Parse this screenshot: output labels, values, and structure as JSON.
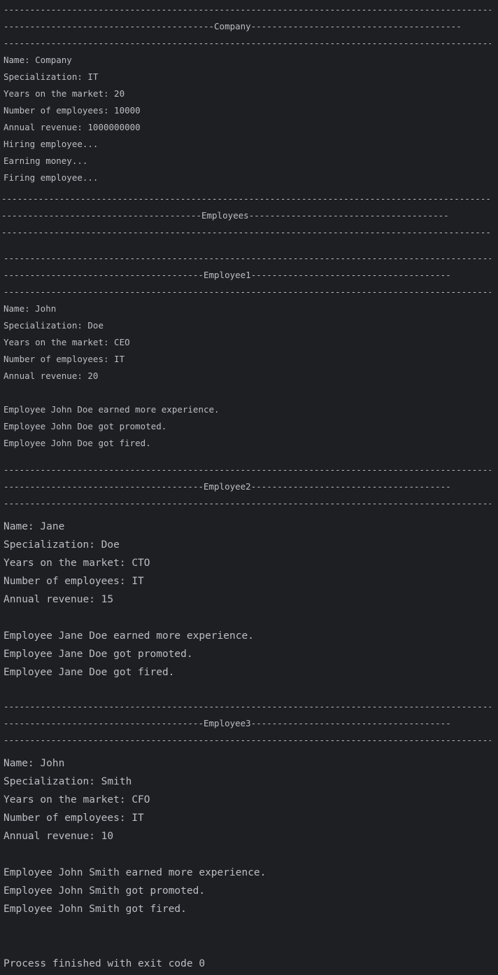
{
  "console": {
    "company": {
      "dash_line": "------------------------------------------------------------------------------------------------",
      "header": "----------------------------------------Company----------------------------------------",
      "lines": [
        "Name: Company",
        "Specialization: IT",
        "Years on the market: 20",
        "Number of employees: 10000",
        "Annual revenue: 1000000000",
        "Hiring employee...",
        "Earning money...",
        "Firing employee..."
      ]
    },
    "employees_section": {
      "dash_line": "------------------------------------------------------------------------------------------------",
      "header": "--------------------------------------Employees--------------------------------------"
    },
    "employee1": {
      "dash_line": "------------------------------------------------------------------------------------------------",
      "header": "--------------------------------------Employee1--------------------------------------",
      "lines": [
        "Name: John",
        "Specialization: Doe",
        "Years on the market: CEO",
        "Number of employees: IT",
        "Annual revenue: 20"
      ],
      "actions": [
        "Employee John Doe earned more experience.",
        "Employee John Doe got promoted.",
        "Employee John Doe got fired."
      ]
    },
    "employee2": {
      "dash_line": "------------------------------------------------------------------------------------------------",
      "header": "--------------------------------------Employee2--------------------------------------",
      "lines": [
        "Name: Jane",
        "Specialization: Doe",
        "Years on the market: CTO",
        "Number of employees: IT",
        "Annual revenue: 15"
      ],
      "actions": [
        "Employee Jane Doe earned more experience.",
        "Employee Jane Doe got promoted.",
        "Employee Jane Doe got fired."
      ]
    },
    "employee3": {
      "dash_line": "------------------------------------------------------------------------------------------------",
      "header": "--------------------------------------Employee3--------------------------------------",
      "lines": [
        "Name: John",
        "Specialization: Smith",
        "Years on the market: CFO",
        "Number of employees: IT",
        "Annual revenue: 10"
      ],
      "actions": [
        "Employee John Smith earned more experience.",
        "Employee John Smith got promoted.",
        "Employee John Smith got fired."
      ]
    },
    "exit_message": "Process finished with exit code 0"
  }
}
